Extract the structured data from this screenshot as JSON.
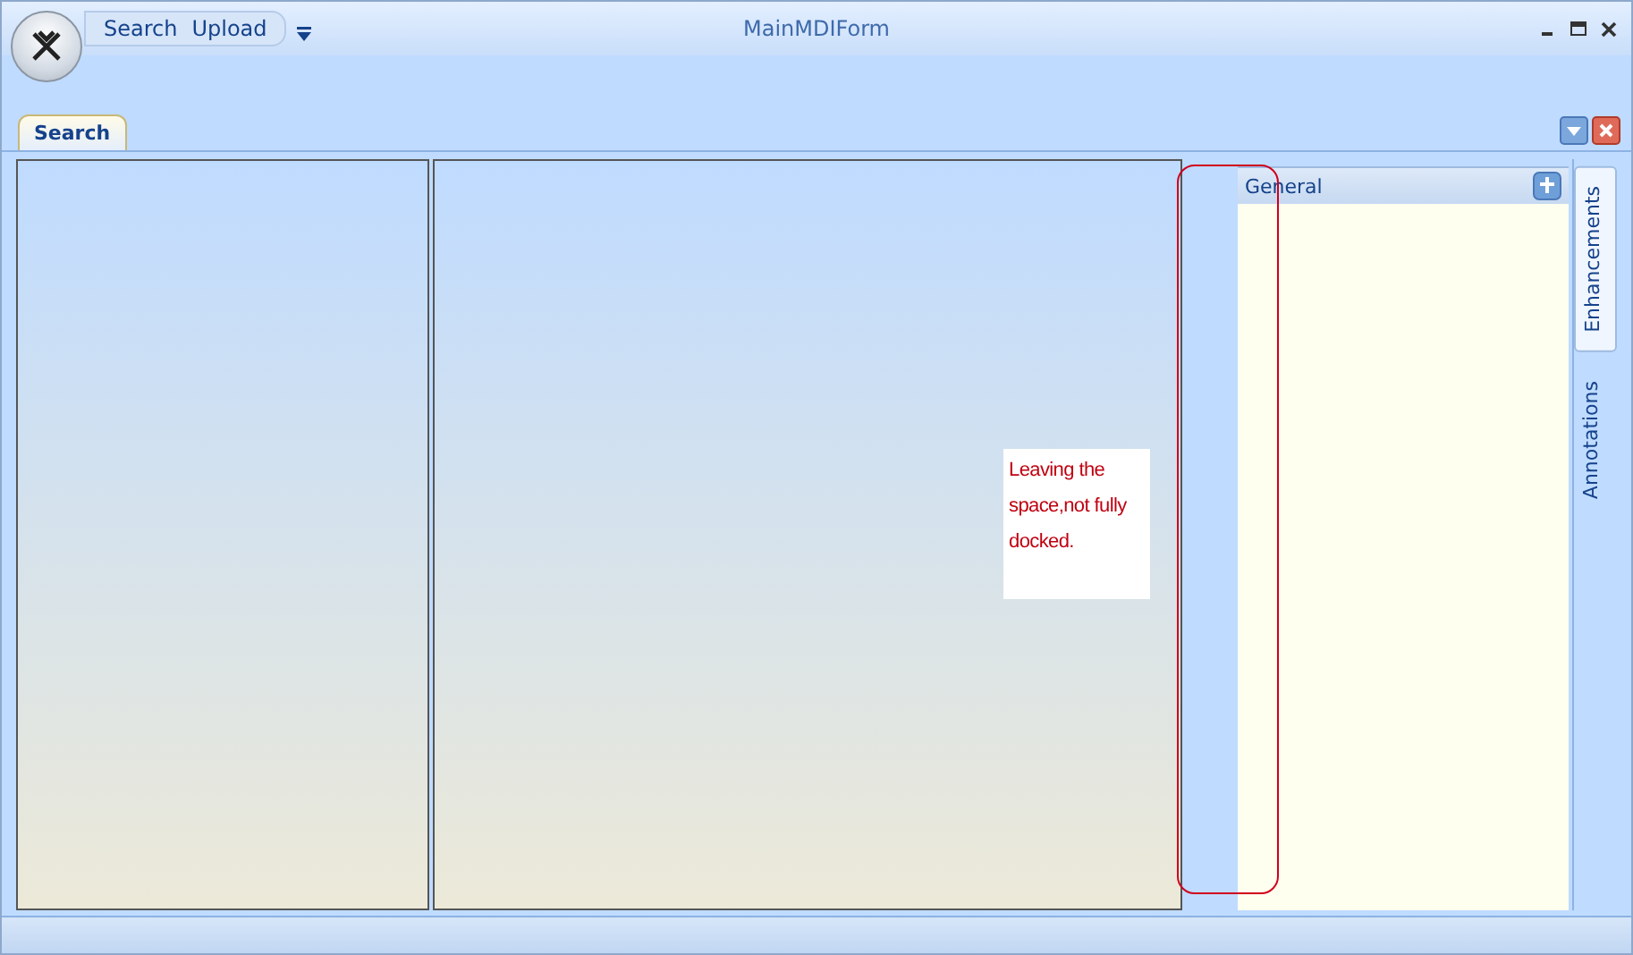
{
  "window": {
    "title": "MainMDIForm"
  },
  "quick_access": [
    "Search",
    "Upload"
  ],
  "ribbon_tabs": [
    {
      "label": "Search",
      "selected": true
    }
  ],
  "note": "Leaving the space,not fully docked.",
  "dock_panel": {
    "title": "General"
  },
  "side_tabs": [
    {
      "label": "Enhancements",
      "selected": true
    },
    {
      "label": "Annotations",
      "selected": false
    }
  ]
}
